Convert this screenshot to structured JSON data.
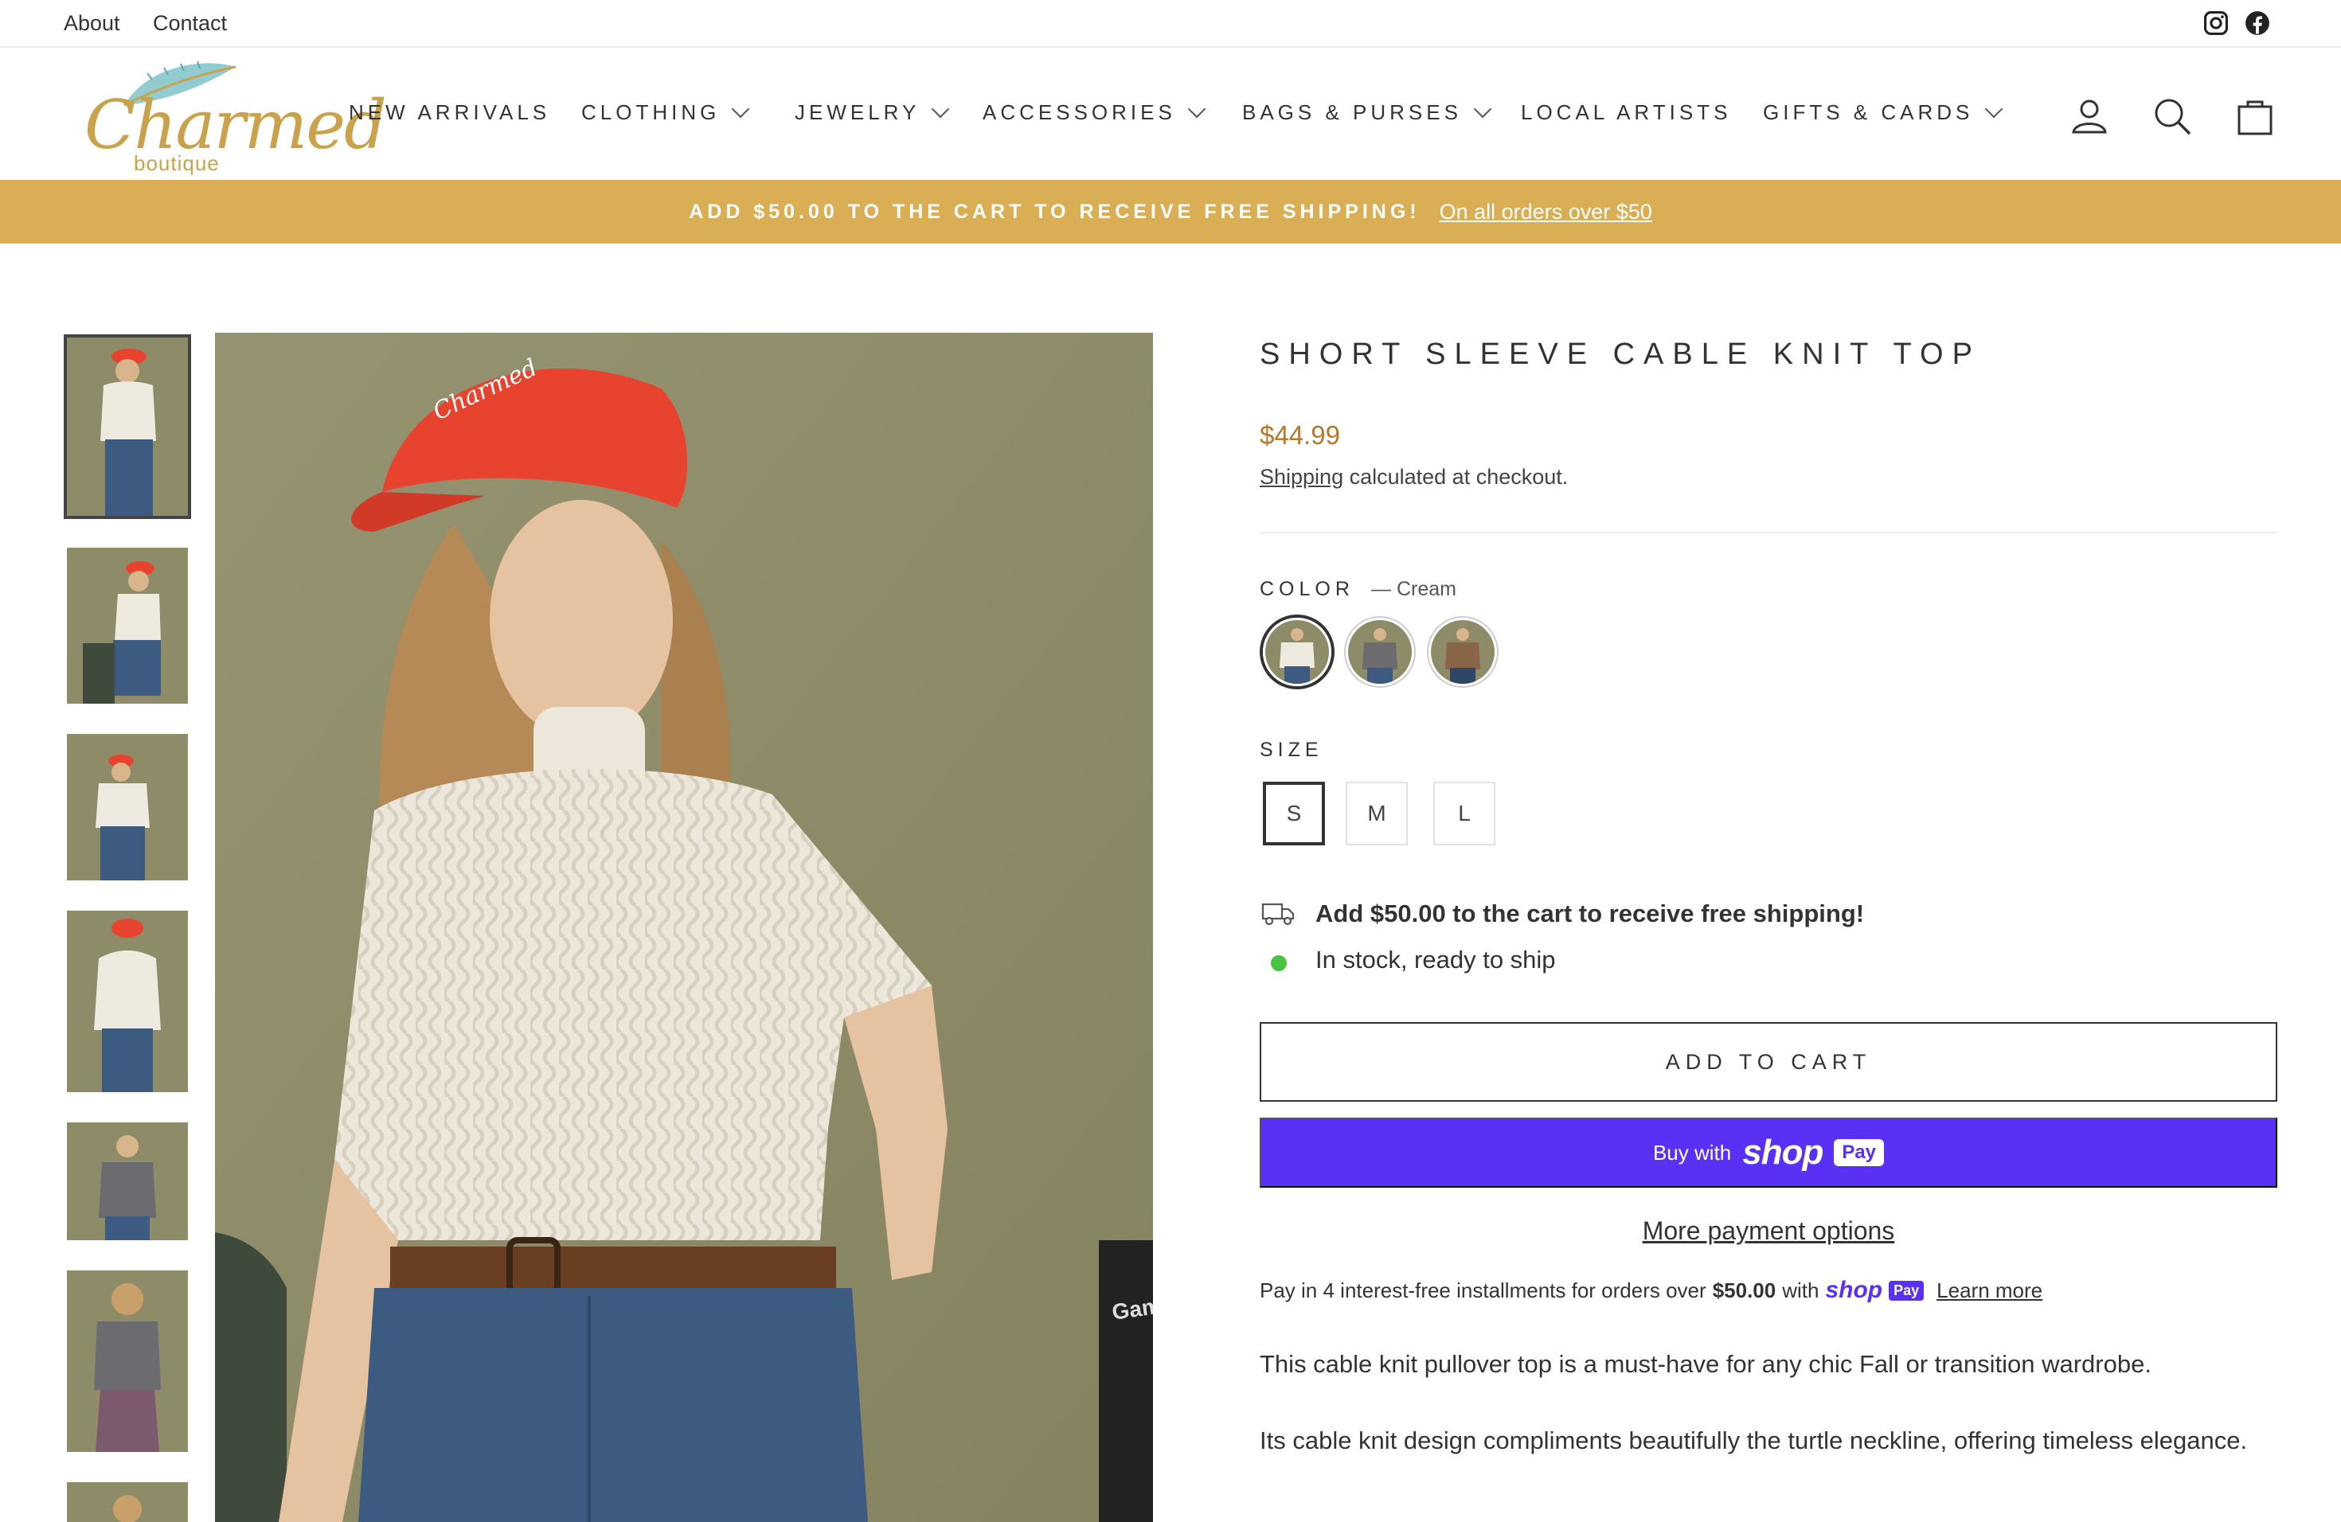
{
  "utility": {
    "about": "About",
    "contact": "Contact",
    "social": [
      "instagram-icon",
      "facebook-icon"
    ]
  },
  "header": {
    "logo_text": "Charmed",
    "logo_sub": "boutique",
    "nav": [
      {
        "label": "NEW ARRIVALS",
        "dropdown": false
      },
      {
        "label": "CLOTHING",
        "dropdown": true
      },
      {
        "label": "JEWELRY",
        "dropdown": true
      },
      {
        "label": "ACCESSORIES",
        "dropdown": true
      },
      {
        "label": "BAGS & PURSES",
        "dropdown": true
      },
      {
        "label": "LOCAL ARTISTS",
        "dropdown": false
      },
      {
        "label": "GIFTS & CARDS",
        "dropdown": true
      }
    ],
    "icons": [
      "account-icon",
      "search-icon",
      "cart-icon"
    ]
  },
  "announcement": {
    "message": "ADD $50.00 TO THE CART TO RECEIVE FREE SHIPPING!",
    "link": "On all orders over $50"
  },
  "product": {
    "title": "SHORT SLEEVE CABLE KNIT TOP",
    "price": "$44.99",
    "shipping_link": "Shipping",
    "shipping_rest": " calculated at checkout.",
    "color_label": "COLOR",
    "color_value": "— Cream",
    "colors": [
      {
        "name": "Cream",
        "hex": "#eee9dc",
        "selected": true
      },
      {
        "name": "Grey",
        "hex": "#6c6c70",
        "selected": false
      },
      {
        "name": "Brown",
        "hex": "#8a6446",
        "selected": false
      }
    ],
    "size_label": "SIZE",
    "sizes": [
      {
        "label": "S",
        "selected": true
      },
      {
        "label": "M",
        "selected": false
      },
      {
        "label": "L",
        "selected": false
      }
    ],
    "free_shipping_notice": "Add $50.00 to the cart to receive free shipping!",
    "stock_status": "In stock, ready to ship",
    "stock_color": "#4ac33f",
    "add_to_cart": "ADD TO CART",
    "shop_pay": {
      "buy_with": "Buy with",
      "brand": "shop",
      "pay": "Pay",
      "color": "#5a31f4"
    },
    "more_payment": "More payment options",
    "installments": {
      "prefix": "Pay in 4 interest-free installments for orders over",
      "amount": "$50.00",
      "with": "with",
      "learn_more": "Learn more"
    },
    "description": [
      "This cable knit pullover top is a must-have for any chic Fall or transition wardrobe.",
      "Its cable knit design compliments beautifully the turtle neckline, offering timeless elegance."
    ]
  },
  "colors": {
    "gold": "#d9ae55",
    "price": "#b5782b",
    "text": "#333333"
  }
}
